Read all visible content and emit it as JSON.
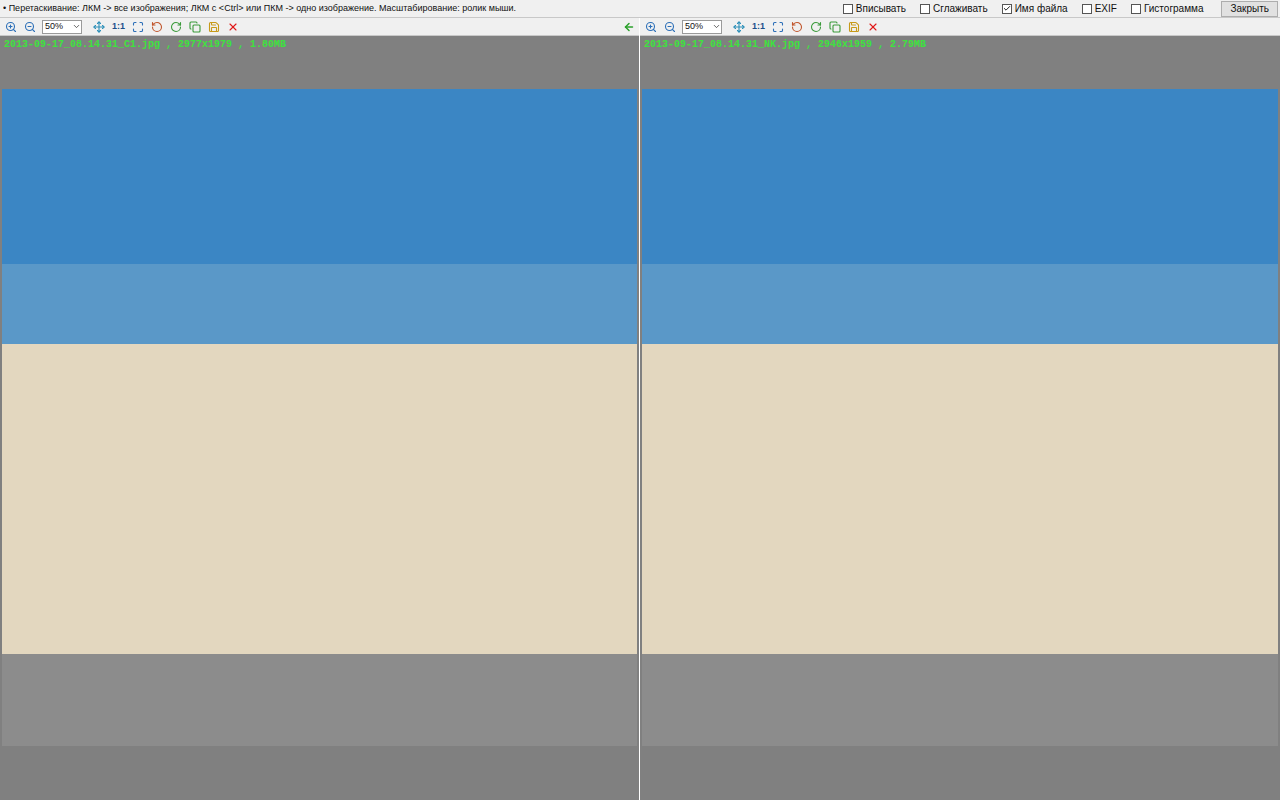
{
  "window": {
    "hint": "• Перетаскивание: ЛКМ -> все изображения; ЛКМ с <Ctrl> или ПКМ -> одно изображение. Масштабирование: ролик мыши."
  },
  "options": [
    {
      "label": "Вписывать",
      "checked": false
    },
    {
      "label": "Сглаживать",
      "checked": false
    },
    {
      "label": "Имя файла",
      "checked": true
    },
    {
      "label": "EXIF",
      "checked": false
    },
    {
      "label": "Гистограмма",
      "checked": false
    }
  ],
  "close_button": "Закрыть",
  "panels": [
    {
      "zoom": "50%",
      "actual_size": "1:1",
      "file_label": "2013-09-17_08.14.31_C1.jpg , 2977x1979 , 1.80MB",
      "sync_arrow": true
    },
    {
      "zoom": "50%",
      "actual_size": "1:1",
      "file_label": "2013-09-17_08.14.31_NK.jpg , 2946x1959 , 2.79MB",
      "sync_arrow": false
    }
  ]
}
